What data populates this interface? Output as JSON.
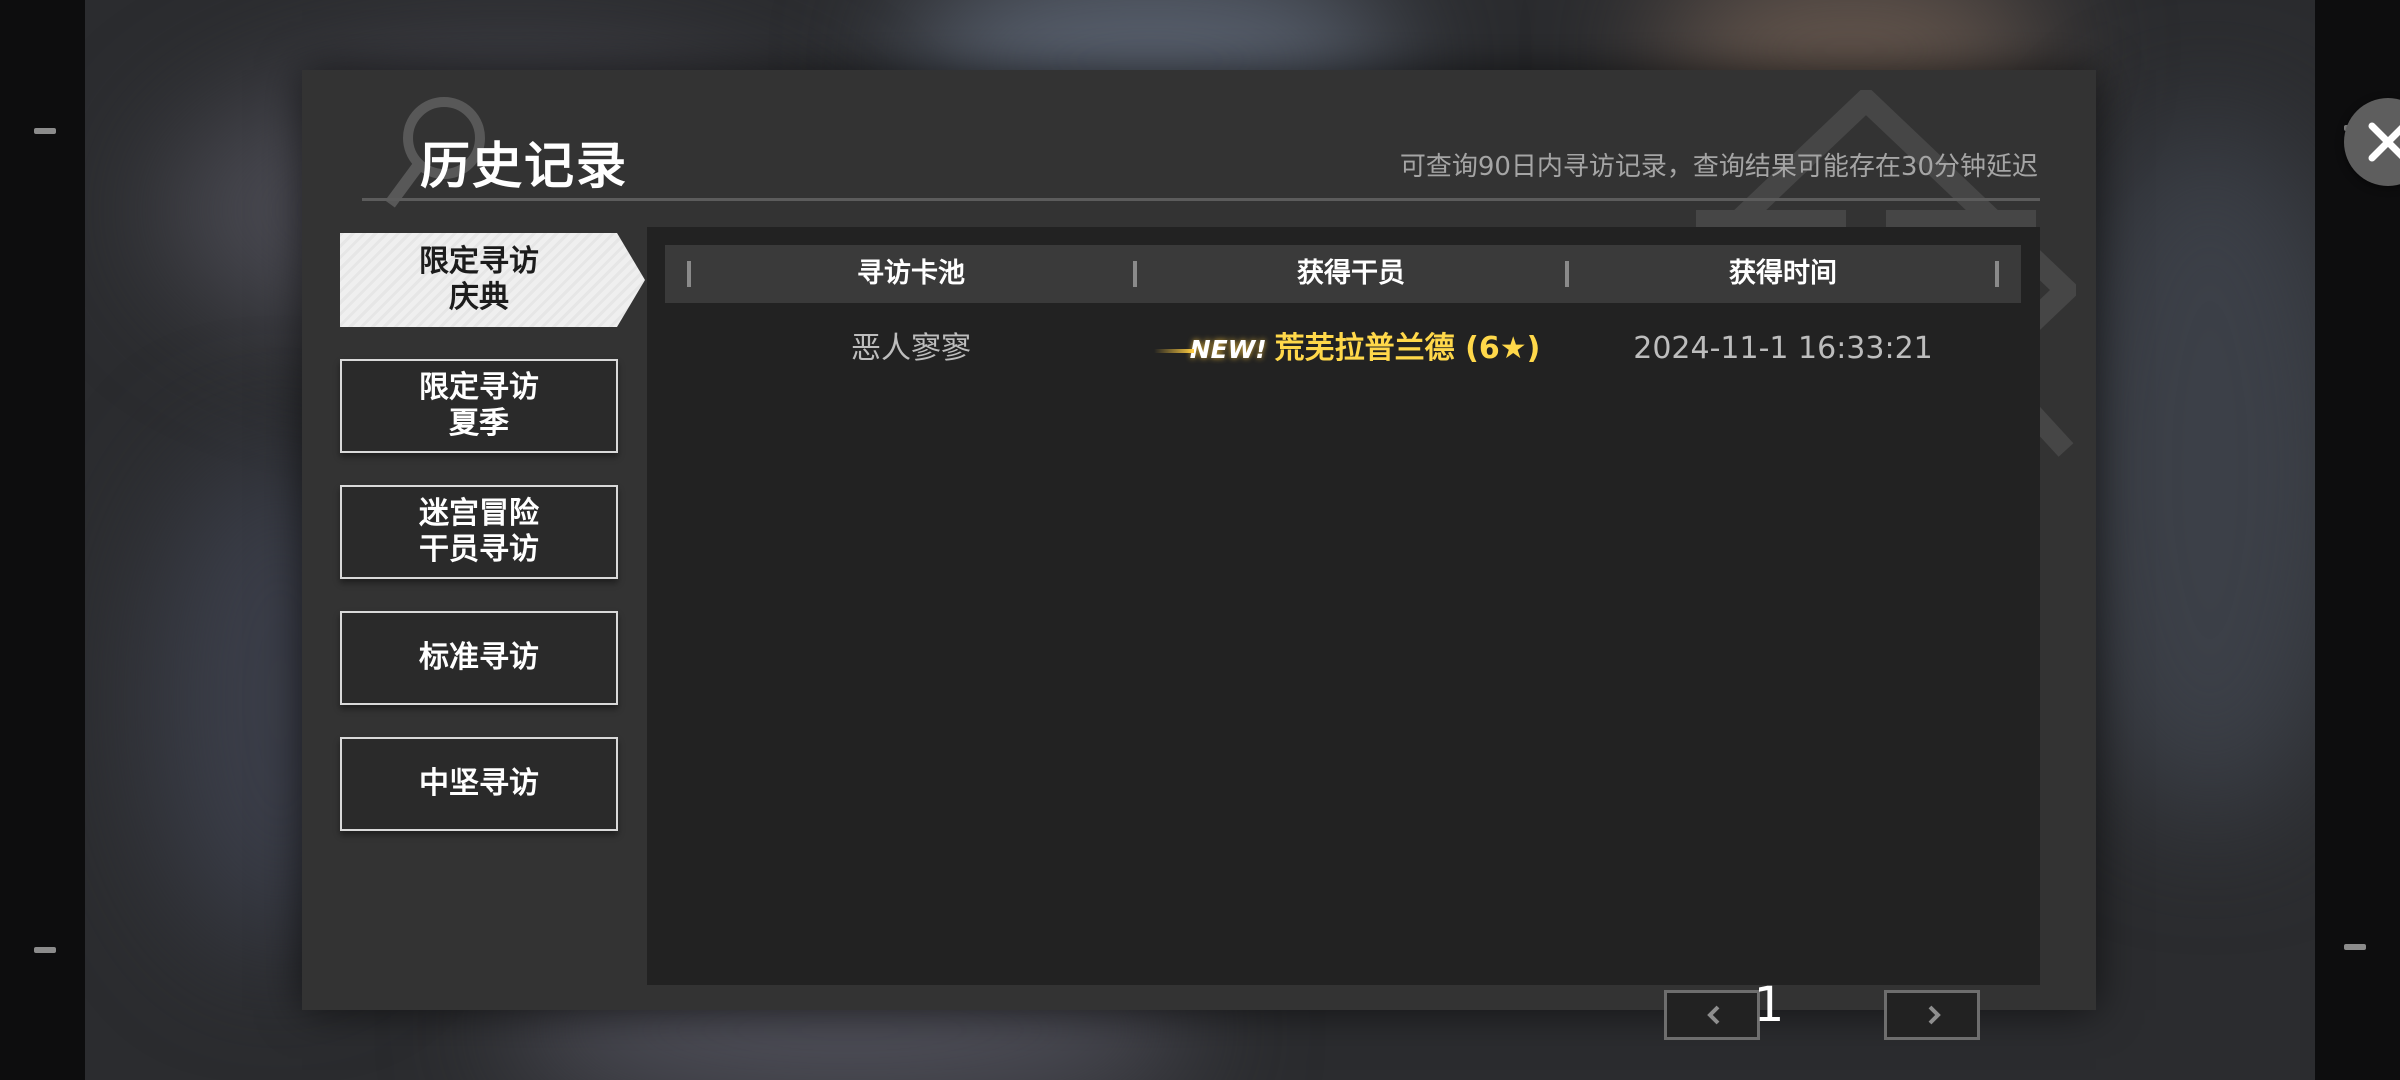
{
  "dialog": {
    "title": "历史记录",
    "subtitle": "可查询90日内寻访记录，查询结果可能存在30分钟延迟"
  },
  "tabs": [
    {
      "line1": "限定寻访",
      "line2": "庆典",
      "active": true
    },
    {
      "line1": "限定寻访",
      "line2": "夏季",
      "active": false
    },
    {
      "line1": "迷宫冒险",
      "line2": "干员寻访",
      "active": false
    },
    {
      "line1": "标准寻访",
      "line2": "",
      "active": false
    },
    {
      "line1": "中坚寻访",
      "line2": "",
      "active": false
    }
  ],
  "table": {
    "headers": [
      "寻访卡池",
      "获得干员",
      "获得时间"
    ],
    "rows": [
      {
        "pool": "恶人寥寥",
        "new_badge": "NEW!",
        "operator": "荒芜拉普兰德 (6★)",
        "time": "2024-11-1 16:33:21"
      }
    ]
  },
  "pager": {
    "page": "1"
  },
  "icons": {
    "close": "close-icon",
    "prev": "chevron-left-icon",
    "next": "chevron-right-icon"
  },
  "colors": {
    "highlight": "#ffd84a",
    "panel": "#222222",
    "dialog": "#333333"
  }
}
